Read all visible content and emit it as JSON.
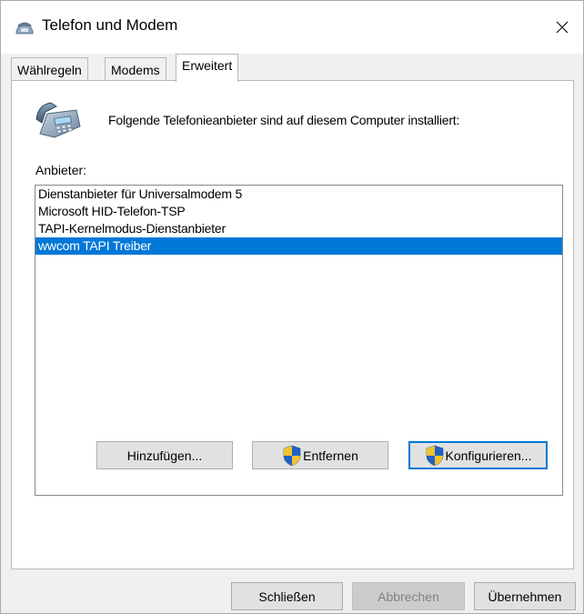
{
  "window": {
    "title": "Telefon und Modem",
    "title_icon": "telephone-icon",
    "close_icon": "close-icon"
  },
  "tabs": [
    {
      "label": "Wählregeln",
      "active": false
    },
    {
      "label": "Modems",
      "active": false
    },
    {
      "label": "Erweitert",
      "active": true
    }
  ],
  "advanced": {
    "icon": "telephone-icon",
    "info_text": "Folgende Telefonieanbieter sind auf diesem Computer installiert:",
    "providers_label": "Anbieter:",
    "providers": [
      {
        "label": "Dienstanbieter für Universalmodem 5",
        "selected": false
      },
      {
        "label": "Microsoft HID-Telefon-TSP",
        "selected": false
      },
      {
        "label": "TAPI-Kernelmodus-Dienstanbieter",
        "selected": false
      },
      {
        "label": "wwcom TAPI Treiber",
        "selected": true
      }
    ],
    "buttons": {
      "add": "Hinzufügen...",
      "remove": "Entfernen",
      "configure": "Konfigurieren..."
    }
  },
  "footer": {
    "close": "Schließen",
    "cancel": "Abbrechen",
    "apply": "Übernehmen"
  },
  "colors": {
    "selection": "#0078d7",
    "focus_border": "#0078d7",
    "dialog_background": "#f0f0f0"
  }
}
